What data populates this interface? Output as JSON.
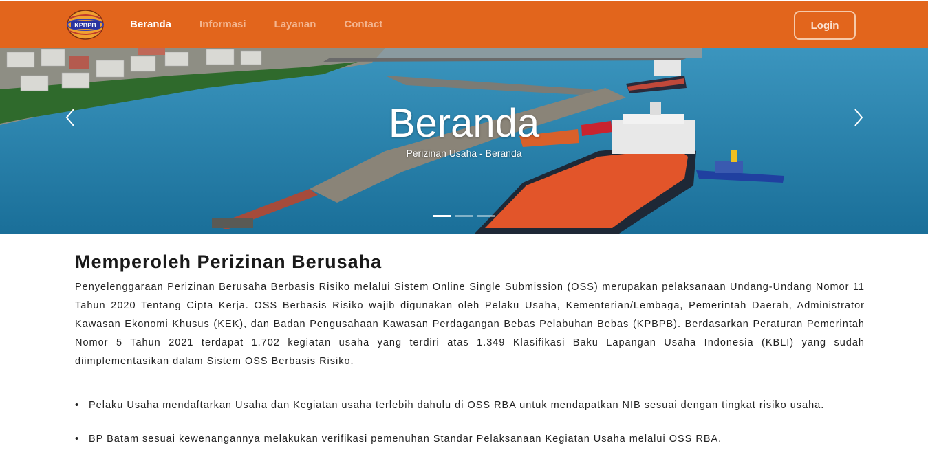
{
  "navbar": {
    "logo_text": "KPBPB",
    "links": [
      {
        "label": "Beranda",
        "active": true
      },
      {
        "label": "Informasi",
        "active": false
      },
      {
        "label": "Layanan",
        "active": false
      },
      {
        "label": "Contact",
        "active": false
      }
    ],
    "login_label": "Login",
    "color": "#e2651c"
  },
  "hero": {
    "title": "Beranda",
    "subtitle": "Perizinan Usaha - Beranda",
    "active_slide": 1,
    "slide_count": 3
  },
  "main": {
    "title": "Memperoleh Perizinan Berusaha",
    "paragraph": "Penyelenggaraan Perizinan Berusaha Berbasis Risiko melalui Sistem Online Single Submission (OSS) merupakan pelaksanaan Undang-Undang Nomor 11 Tahun 2020 Tentang Cipta Kerja. OSS Berbasis Risiko wajib digunakan oleh Pelaku Usaha, Kementerian/Lembaga, Pemerintah Daerah, Administrator Kawasan Ekonomi Khusus (KEK), dan Badan Pengusahaan Kawasan Perdagangan Bebas Pelabuhan Bebas (KPBPB). Berdasarkan Peraturan Pemerintah Nomor 5 Tahun 2021 terdapat 1.702 kegiatan usaha yang terdiri atas 1.349 Klasifikasi Baku Lapangan Usaha Indonesia (KBLI) yang sudah diimplementasikan dalam Sistem OSS Berbasis Risiko.",
    "bullets": [
      "Pelaku Usaha mendaftarkan Usaha dan Kegiatan usaha terlebih dahulu di OSS RBA untuk mendapatkan NIB sesuai dengan tingkat risiko usaha.",
      "BP Batam sesuai kewenangannya melakukan verifikasi pemenuhan Standar Pelaksanaan Kegiatan Usaha melalui OSS RBA."
    ]
  }
}
